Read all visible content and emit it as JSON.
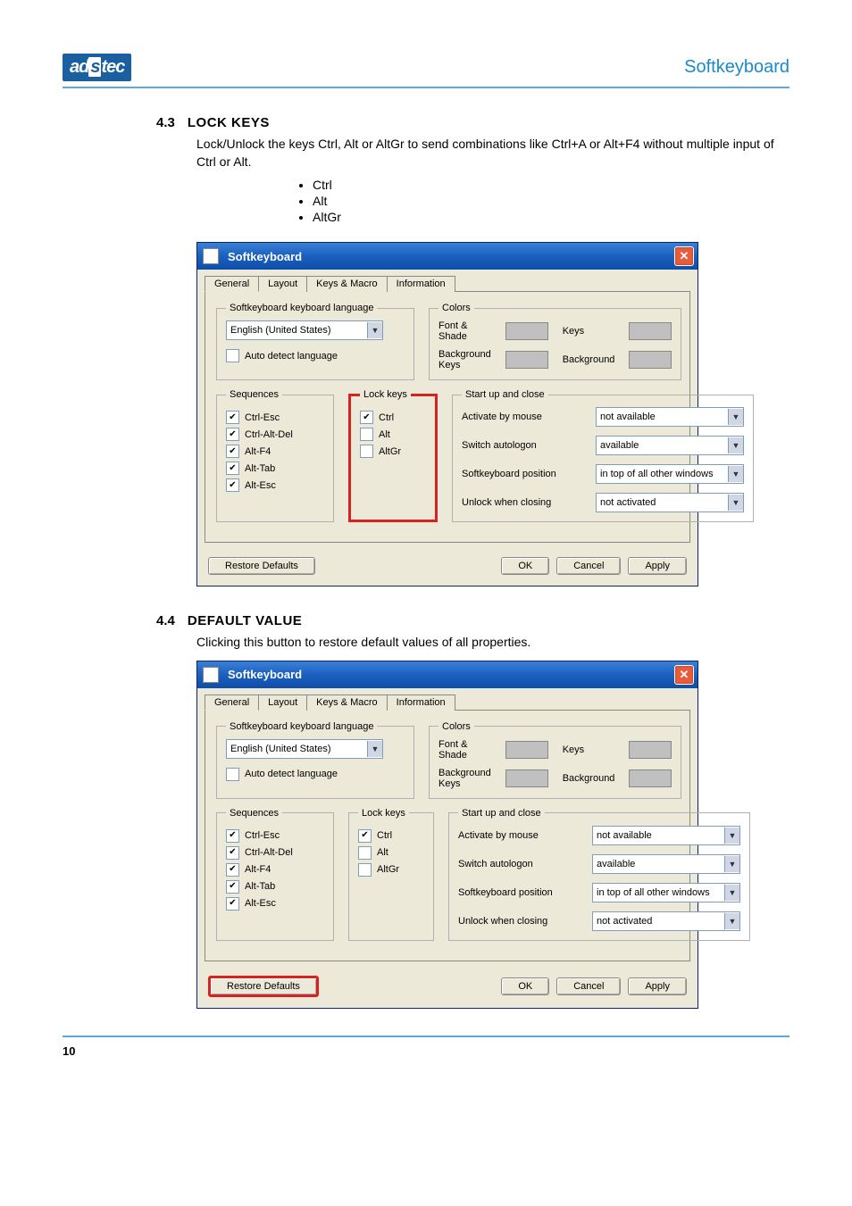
{
  "header": {
    "logo": "adstec",
    "right": "Softkeyboard"
  },
  "sec1": {
    "num": "4.3",
    "title": "LOCK KEYS",
    "para": "Lock/Unlock the keys Ctrl, Alt or AltGr to send combinations like Ctrl+A or Alt+F4 without multiple input of Ctrl or Alt.",
    "bullets": [
      "Ctrl",
      "Alt",
      "AltGr"
    ]
  },
  "sec2": {
    "num": "4.4",
    "title": "DEFAULT VALUE",
    "para": "Clicking this button to restore default values of all properties."
  },
  "dialog": {
    "title": "Softkeyboard",
    "tabs": [
      "General",
      "Layout",
      "Keys & Macro",
      "Information"
    ],
    "lang": {
      "legend": "Softkeyboard keyboard language",
      "value": "English (United States)",
      "auto": "Auto detect language"
    },
    "colors": {
      "legend": "Colors",
      "font": "Font & Shade",
      "keys": "Keys",
      "bgkeys": "Background Keys",
      "bg": "Background"
    },
    "sequences": {
      "legend": "Sequences",
      "items": [
        "Ctrl-Esc",
        "Ctrl-Alt-Del",
        "Alt-F4",
        "Alt-Tab",
        "Alt-Esc"
      ]
    },
    "lockkeys": {
      "legend": "Lock keys",
      "items": [
        {
          "label": "Ctrl",
          "checked": true
        },
        {
          "label": "Alt",
          "checked": false
        },
        {
          "label": "AltGr",
          "checked": false
        }
      ]
    },
    "startup": {
      "legend": "Start up and close",
      "rows": [
        {
          "label": "Activate by mouse",
          "value": "not available"
        },
        {
          "label": "Switch autologon",
          "value": "available"
        },
        {
          "label": "Softkeyboard position",
          "value": "in top of all other windows"
        },
        {
          "label": "Unlock when closing",
          "value": "not activated"
        }
      ]
    },
    "buttons": {
      "restore": "Restore Defaults",
      "ok": "OK",
      "cancel": "Cancel",
      "apply": "Apply"
    }
  },
  "page_num": "10"
}
